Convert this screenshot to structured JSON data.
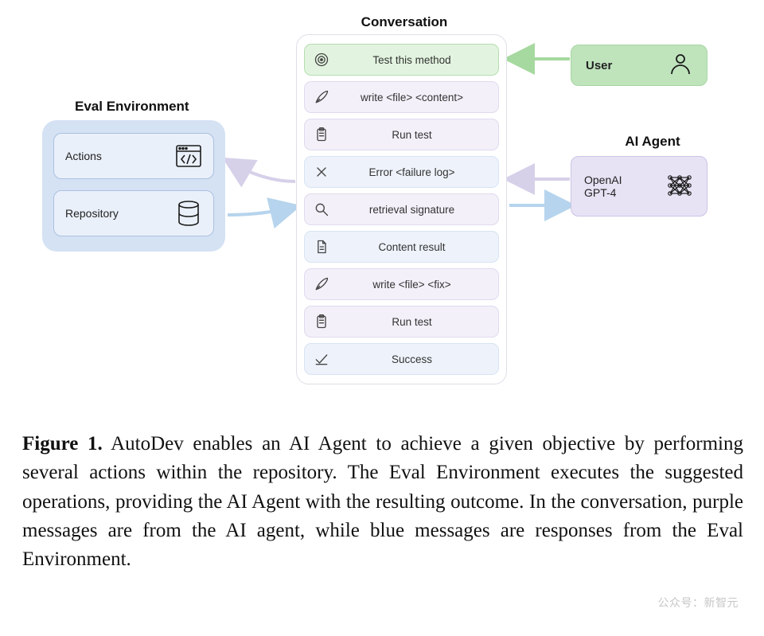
{
  "titles": {
    "conversation": "Conversation",
    "eval_env": "Eval Environment",
    "ai_agent": "AI Agent"
  },
  "eval": {
    "actions": "Actions",
    "repository": "Repository"
  },
  "user": {
    "label": "User"
  },
  "agent": {
    "line1": "OpenAI",
    "line2": "GPT-4"
  },
  "messages": [
    {
      "text": "Test this method",
      "kind": "green",
      "icon": "target-icon"
    },
    {
      "text": "write <file> <content>",
      "kind": "purple",
      "icon": "quill-icon"
    },
    {
      "text": "Run test",
      "kind": "purple",
      "icon": "clipboard-icon"
    },
    {
      "text": "Error <failure log>",
      "kind": "blue",
      "icon": "x-icon"
    },
    {
      "text": "retrieval signature",
      "kind": "purple",
      "icon": "search-icon"
    },
    {
      "text": "Content result",
      "kind": "blue",
      "icon": "document-icon"
    },
    {
      "text": "write <file> <fix>",
      "kind": "purple",
      "icon": "quill-icon"
    },
    {
      "text": "Run test",
      "kind": "purple",
      "icon": "clipboard-icon"
    },
    {
      "text": "Success",
      "kind": "blue",
      "icon": "check-icon"
    }
  ],
  "caption": {
    "prefix": "Figure 1.",
    "body": " AutoDev enables an AI Agent to achieve a given objective by performing several actions within the repository. The Eval Environment executes the suggested operations, providing the AI Agent with the resulting outcome. In the conversation, purple messages are from the AI agent, while blue messages are responses from the Eval Environment."
  },
  "watermark": "公众号：新智元",
  "colors": {
    "green_bg": "#e2f4df",
    "purple_bg": "#f3f0f9",
    "blue_bg": "#eef3fb",
    "eval_bg": "#d5e2f4",
    "user_bg": "#bfe4bc",
    "agent_bg": "#e7e3f4",
    "arrow_green": "#a6d99f",
    "arrow_purple": "#d7d0e9",
    "arrow_blue": "#b6d4ed"
  }
}
